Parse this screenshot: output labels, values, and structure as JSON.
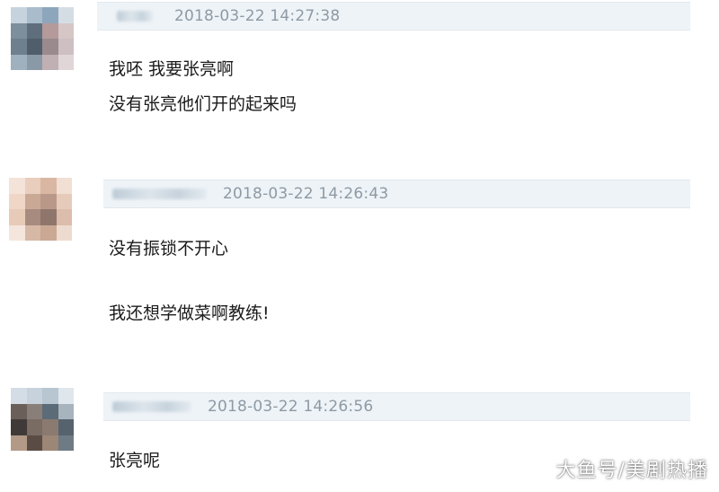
{
  "comments": [
    {
      "timestamp": "2018-03-22 14:27:38",
      "lines": [
        "我呸 我要张亮啊",
        "没有张亮他们开的起来吗"
      ],
      "avatar_colors": [
        "#c6d3de",
        "#a9bccc",
        "#8ea6bb",
        "#d5dde4",
        "#7d8e9c",
        "#5e6e7c",
        "#b49a9a",
        "#d6c6c6",
        "#6e7f8d",
        "#4f5e6a",
        "#9a8a8e",
        "#cdbfc2",
        "#9fb0be",
        "#8a99a6",
        "#c0b0b3",
        "#e0d6d8"
      ]
    },
    {
      "timestamp": "2018-03-22 14:26:43",
      "lines": [
        "没有振锁不开心",
        "我还想学做菜啊教练!"
      ],
      "avatar_colors": [
        "#f3e3d8",
        "#e9cdbd",
        "#d9b7a3",
        "#f1dfd3",
        "#efd6c6",
        "#c9a996",
        "#b9988a",
        "#e6cbbb",
        "#e8cab8",
        "#a88b7f",
        "#8f766c",
        "#dcbcaa",
        "#f4e6dc",
        "#d6b8a6",
        "#caa893",
        "#eedbcf"
      ]
    },
    {
      "timestamp": "2018-03-22 14:26:56",
      "lines": [
        "张亮呢"
      ],
      "avatar_colors": [
        "#d4dde5",
        "#c7d2dc",
        "#b8c6d2",
        "#dfe6ec",
        "#6b5f59",
        "#8a7f78",
        "#5c6b78",
        "#a7b3bd",
        "#3f3a38",
        "#7a6b63",
        "#8b7a70",
        "#56636e",
        "#b39a86",
        "#5a4c45",
        "#9c8676",
        "#6f7b84"
      ]
    }
  ],
  "watermark": "大鱼号/美剧热播"
}
